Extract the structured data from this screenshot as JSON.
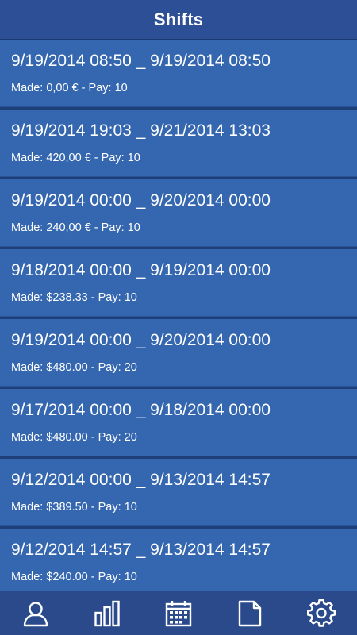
{
  "header": {
    "title": "Shifts"
  },
  "shifts": [
    {
      "range": "9/19/2014 08:50 _ 9/19/2014 08:50",
      "made": "Made: 0,00 € - Pay: 10"
    },
    {
      "range": "9/19/2014 19:03 _ 9/21/2014 13:03",
      "made": "Made: 420,00 € - Pay: 10"
    },
    {
      "range": "9/19/2014 00:00 _ 9/20/2014 00:00",
      "made": "Made: 240,00 € - Pay: 10"
    },
    {
      "range": "9/18/2014 00:00 _ 9/19/2014 00:00",
      "made": "Made: $238.33 - Pay: 10"
    },
    {
      "range": "9/19/2014 00:00 _ 9/20/2014 00:00",
      "made": "Made: $480.00 - Pay: 20"
    },
    {
      "range": "9/17/2014 00:00 _ 9/18/2014 00:00",
      "made": "Made: $480.00 - Pay: 20"
    },
    {
      "range": "9/12/2014 00:00 _ 9/13/2014 14:57",
      "made": "Made: $389.50 - Pay: 10"
    },
    {
      "range": "9/12/2014 14:57 _ 9/13/2014 14:57",
      "made": "Made: $240.00 - Pay: 10"
    }
  ],
  "bottom_nav": {
    "items": [
      {
        "icon": "person-icon"
      },
      {
        "icon": "bar-chart-icon"
      },
      {
        "icon": "calendar-icon"
      },
      {
        "icon": "document-icon"
      },
      {
        "icon": "gear-icon"
      }
    ]
  },
  "colors": {
    "header_bg": "#2c4f96",
    "item_bg": "#3467b0",
    "divider": "#1f3f78",
    "nav_bg": "#2a4a8c",
    "text": "#ffffff"
  }
}
